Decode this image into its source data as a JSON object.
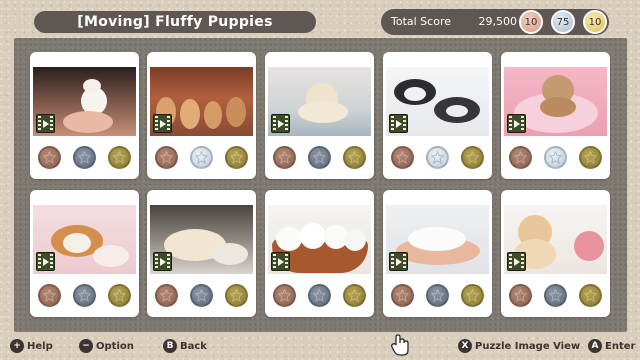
{
  "header": {
    "title": "[Moving] Fluffy Puppies",
    "score_label": "Total Score",
    "score_value": "29,500",
    "medals": {
      "bronze": "10",
      "silver": "75",
      "gold": "10"
    }
  },
  "cards": [
    {
      "name": "puppy-1",
      "silver_earned": false
    },
    {
      "name": "puppy-2",
      "silver_earned": true
    },
    {
      "name": "puppy-3",
      "silver_earned": false
    },
    {
      "name": "puppy-4",
      "silver_earned": true
    },
    {
      "name": "puppy-5",
      "silver_earned": true
    },
    {
      "name": "puppy-6",
      "silver_earned": false
    },
    {
      "name": "puppy-7",
      "silver_earned": false
    },
    {
      "name": "puppy-8",
      "silver_earned": false
    },
    {
      "name": "puppy-9",
      "silver_earned": false
    },
    {
      "name": "puppy-10",
      "silver_earned": false
    }
  ],
  "footer": {
    "help": {
      "button": "+",
      "label": "Help"
    },
    "option": {
      "button": "−",
      "label": "Option"
    },
    "back": {
      "button": "B",
      "label": "Back"
    },
    "puzzle_view": {
      "button": "X",
      "label": "Puzzle Image View"
    },
    "enter": {
      "button": "A",
      "label": "Enter"
    }
  },
  "icons": {
    "medal_star": "star-icon",
    "film": "film-icon",
    "cursor": "hand-cursor-icon"
  },
  "colors": {
    "bar_dark": "#5e5754",
    "board": "#7f7a72",
    "bronze": "#8a5f4d",
    "silver": "#5d6878",
    "silver_earned": "#b9c8d5",
    "gold": "#8a7a32"
  }
}
